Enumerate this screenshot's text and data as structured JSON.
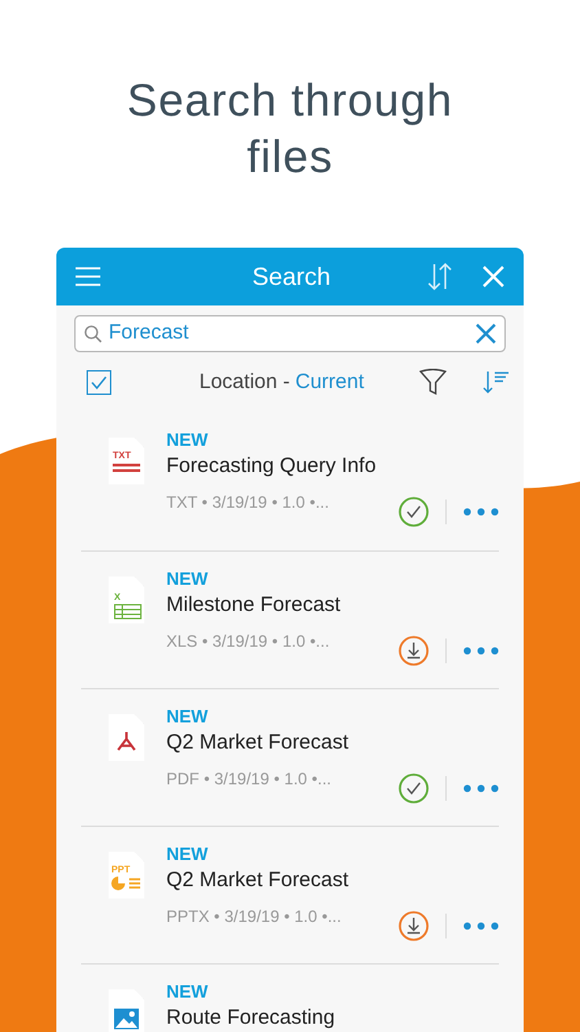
{
  "headline": "Search through files",
  "header": {
    "title": "Search"
  },
  "search": {
    "value": "Forecast"
  },
  "toolbar": {
    "select_all_checked": true,
    "location_label": "Location -",
    "location_value": "Current"
  },
  "files": [
    {
      "kind": "txt",
      "icon_label": "TXT",
      "badge": "NEW",
      "name": "Forecasting Query Info",
      "meta": "TXT • 3/19/19 • 1.0 •...",
      "downloaded": true
    },
    {
      "kind": "xls",
      "icon_label": "X",
      "badge": "NEW",
      "name": "Milestone Forecast",
      "meta": "XLS • 3/19/19 • 1.0 •...",
      "downloaded": false
    },
    {
      "kind": "pdf",
      "badge": "NEW",
      "name": "Q2 Market Forecast",
      "meta": "PDF • 3/19/19 • 1.0 •...",
      "downloaded": true
    },
    {
      "kind": "ppt",
      "icon_label": "PPT",
      "badge": "NEW",
      "name": "Q2 Market Forecast",
      "meta": "PPTX • 3/19/19 • 1.0 •...",
      "downloaded": false
    },
    {
      "kind": "image",
      "badge": "NEW",
      "name": "Route Forecasting"
    }
  ]
}
